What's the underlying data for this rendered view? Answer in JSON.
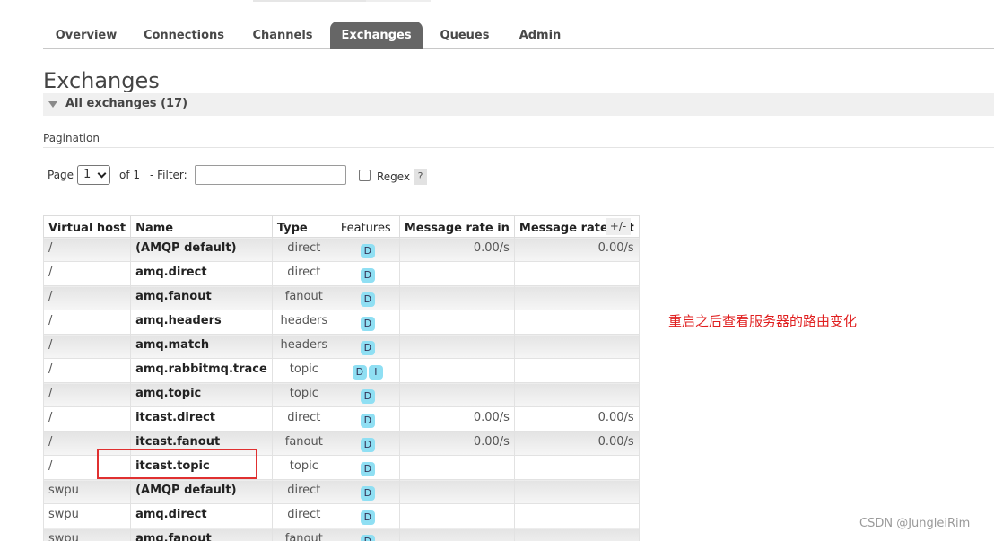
{
  "nav": {
    "tabs": [
      {
        "label": "Overview"
      },
      {
        "label": "Connections"
      },
      {
        "label": "Channels"
      },
      {
        "label": "Exchanges"
      },
      {
        "label": "Queues"
      },
      {
        "label": "Admin"
      }
    ],
    "active": "Exchanges"
  },
  "page": {
    "title": "Exchanges",
    "section_label": "All exchanges (17)"
  },
  "pagination": {
    "label": "Pagination",
    "page_label": "Page",
    "page_value": "1",
    "of_label": "of 1",
    "filter_label": "- Filter:",
    "filter_value": "",
    "regex_label": "Regex",
    "help_label": "?"
  },
  "table": {
    "headers": [
      "Virtual host",
      "Name",
      "Type",
      "Features",
      "Message rate in",
      "Message rate out"
    ],
    "columns_toggle": "+/-",
    "rows": [
      {
        "vhost": "/",
        "name": "(AMQP default)",
        "type": "direct",
        "features": [
          "D"
        ],
        "rate_in": "0.00/s",
        "rate_out": "0.00/s"
      },
      {
        "vhost": "/",
        "name": "amq.direct",
        "type": "direct",
        "features": [
          "D"
        ],
        "rate_in": "",
        "rate_out": ""
      },
      {
        "vhost": "/",
        "name": "amq.fanout",
        "type": "fanout",
        "features": [
          "D"
        ],
        "rate_in": "",
        "rate_out": ""
      },
      {
        "vhost": "/",
        "name": "amq.headers",
        "type": "headers",
        "features": [
          "D"
        ],
        "rate_in": "",
        "rate_out": ""
      },
      {
        "vhost": "/",
        "name": "amq.match",
        "type": "headers",
        "features": [
          "D"
        ],
        "rate_in": "",
        "rate_out": ""
      },
      {
        "vhost": "/",
        "name": "amq.rabbitmq.trace",
        "type": "topic",
        "features": [
          "D",
          "I"
        ],
        "rate_in": "",
        "rate_out": ""
      },
      {
        "vhost": "/",
        "name": "amq.topic",
        "type": "topic",
        "features": [
          "D"
        ],
        "rate_in": "",
        "rate_out": ""
      },
      {
        "vhost": "/",
        "name": "itcast.direct",
        "type": "direct",
        "features": [
          "D"
        ],
        "rate_in": "0.00/s",
        "rate_out": "0.00/s"
      },
      {
        "vhost": "/",
        "name": "itcast.fanout",
        "type": "fanout",
        "features": [
          "D"
        ],
        "rate_in": "0.00/s",
        "rate_out": "0.00/s"
      },
      {
        "vhost": "/",
        "name": "itcast.topic",
        "type": "topic",
        "features": [
          "D"
        ],
        "rate_in": "",
        "rate_out": ""
      },
      {
        "vhost": "swpu",
        "name": "(AMQP default)",
        "type": "direct",
        "features": [
          "D"
        ],
        "rate_in": "",
        "rate_out": ""
      },
      {
        "vhost": "swpu",
        "name": "amq.direct",
        "type": "direct",
        "features": [
          "D"
        ],
        "rate_in": "",
        "rate_out": ""
      },
      {
        "vhost": "swpu",
        "name": "amq.fanout",
        "type": "fanout",
        "features": [
          "D"
        ],
        "rate_in": "",
        "rate_out": ""
      }
    ]
  },
  "annotation": {
    "text": "重启之后查看服务器的路由变化",
    "color": "#e02020"
  },
  "watermark": "CSDN @JungleiRim"
}
